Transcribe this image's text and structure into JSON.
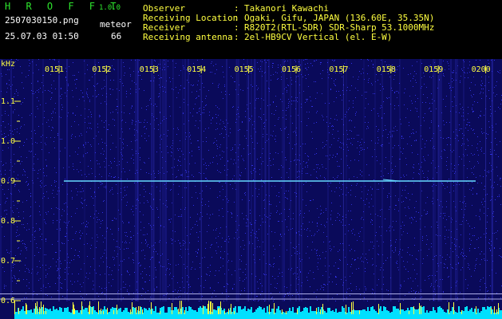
{
  "header": {
    "app_name": "H R O F F T",
    "app_version": "1.0.0",
    "file_name": "2507030150.png",
    "date_time": "25.07.03 01:50",
    "meteor_label": "meteor",
    "meteor_count": "66",
    "info": [
      {
        "key": "Observer",
        "value": "Takanori Kawachi"
      },
      {
        "key": "Receiving Location",
        "value": "Ogaki, Gifu, JAPAN (136.60E, 35.35N)"
      },
      {
        "key": "Receiver",
        "value": "R820T2(RTL-SDR) SDR-Sharp 53.1000MHz"
      },
      {
        "key": "Receiving antenna",
        "value": "2el-HB9CV Vertical (el. E-W)"
      }
    ],
    "colon": ":"
  },
  "chart_data": {
    "type": "heatmap",
    "ylabel": "kHz",
    "y_ticks": [
      "1.1",
      "1.0",
      "0.9",
      "0.8",
      "0.7",
      "0.6"
    ],
    "y_tick_values": [
      1.1,
      1.0,
      0.9,
      0.8,
      0.7,
      0.6
    ],
    "ylim": [
      0.58,
      1.18
    ],
    "time_ticks": [
      "0151",
      "0152",
      "0153",
      "0154",
      "0155",
      "0156",
      "0157",
      "0158",
      "0159",
      "0200"
    ],
    "time_range": [
      "0150",
      "0200"
    ],
    "carrier_khz": 0.9,
    "reference_lines_khz": [
      0.617,
      0.604
    ],
    "colors": {
      "background": "#0a0a5a",
      "carrier": "#66d9ff",
      "tick_label": "#ffff40",
      "grid": "#c8c8ff",
      "noise_floor": "#00e0ff",
      "spikes": "#ffff40"
    }
  }
}
